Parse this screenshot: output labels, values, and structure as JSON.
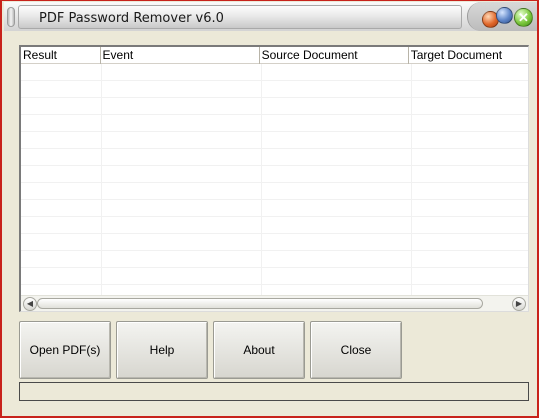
{
  "window": {
    "title": "PDF Password Remover v6.0"
  },
  "title_controls": {
    "close_glyph": "✕"
  },
  "list": {
    "columns": [
      "Result",
      "Event",
      "Source Document",
      "Target Document"
    ],
    "rows": []
  },
  "buttons": {
    "open_label": "Open PDF(s)",
    "help_label": "Help",
    "about_label": "About",
    "close_label": "Close"
  },
  "status": {
    "progress": 0
  },
  "colors": {
    "frame": "#c8221b",
    "face": "#ece9d8",
    "minimize": "#e0672a",
    "maximize": "#5f86c8",
    "close": "#7cc83d"
  }
}
